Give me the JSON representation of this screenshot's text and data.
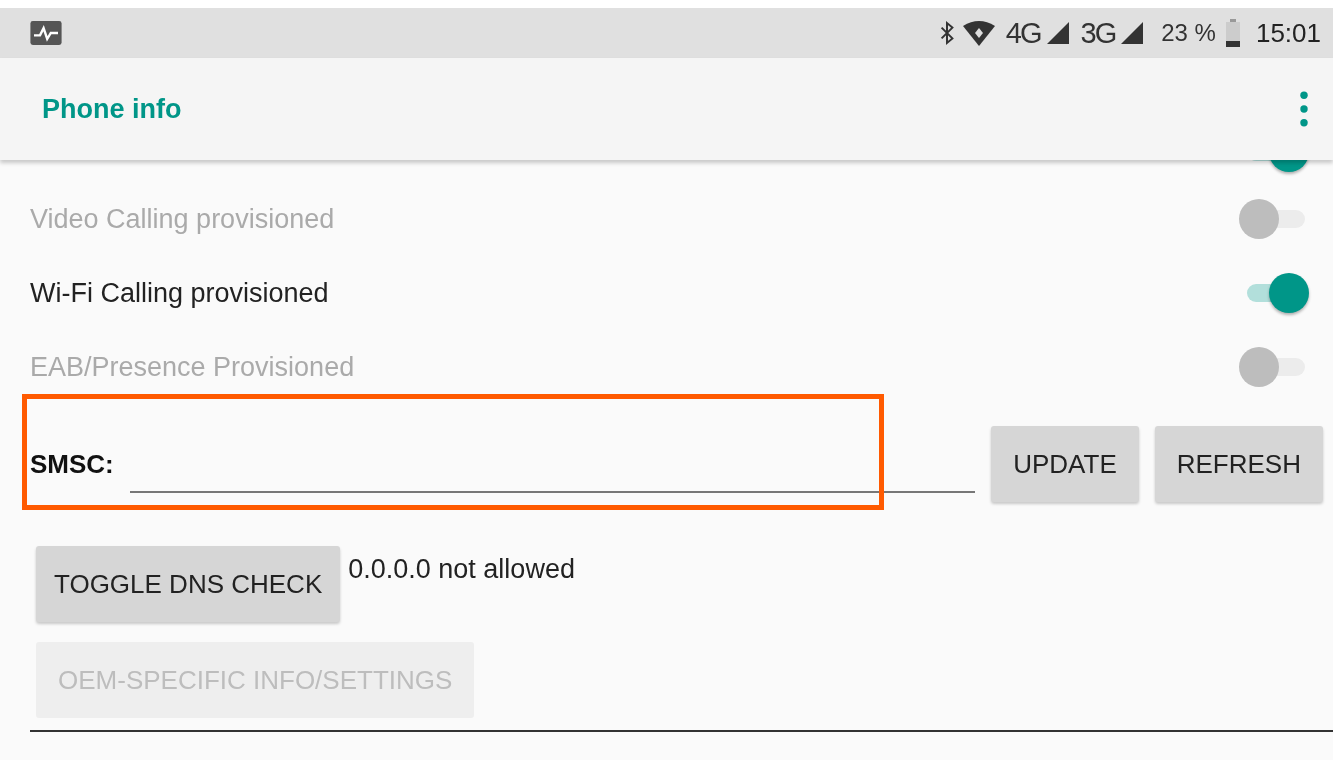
{
  "status_bar": {
    "networks": [
      "4G",
      "3G"
    ],
    "battery": "23 %",
    "time": "15:01"
  },
  "app_bar": {
    "title": "Phone info"
  },
  "toggles": [
    {
      "on": true
    },
    {
      "label": "Video Calling provisioned",
      "on": false,
      "disabled": true
    },
    {
      "label": "Wi-Fi Calling provisioned",
      "on": true,
      "disabled": false
    },
    {
      "label": "EAB/Presence Provisioned",
      "on": false,
      "disabled": true
    }
  ],
  "smsc": {
    "label": "SMSC:",
    "buttons": [
      "UPDATE",
      "REFRESH"
    ]
  },
  "dns": {
    "button": "TOGGLE DNS CHECK",
    "status": "0.0.0.0 not allowed"
  },
  "oem_button": {
    "label": "OEM-SPECIFIC INFO/SETTINGS",
    "disabled": true
  }
}
